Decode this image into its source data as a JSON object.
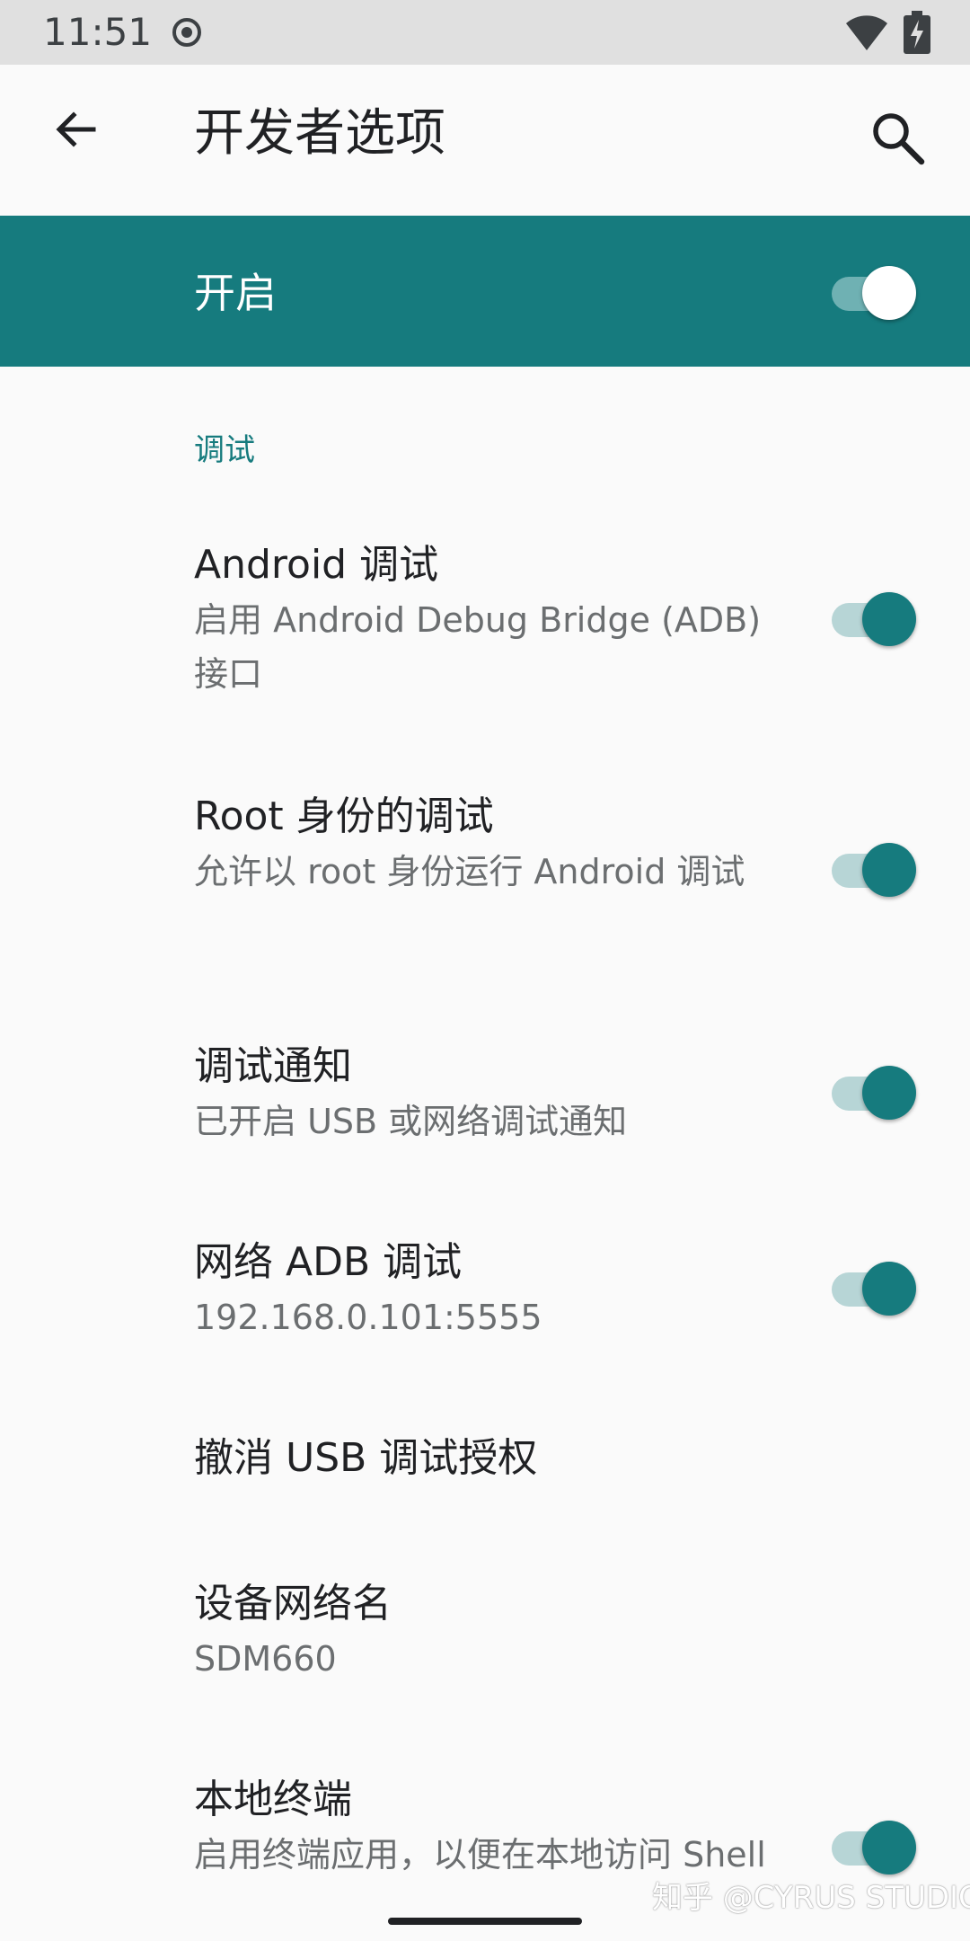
{
  "status_bar": {
    "time": "11:51",
    "icons": [
      "record-icon",
      "wifi-icon",
      "battery-charging-icon"
    ]
  },
  "app_bar": {
    "title": "开发者选项",
    "back_icon": "arrow-back-icon",
    "search_icon": "search-icon"
  },
  "master_switch": {
    "label": "开启",
    "checked": true,
    "color": "#167b7e"
  },
  "section": {
    "header": "调试"
  },
  "prefs": [
    {
      "title": "Android 调试",
      "summary": "启用 Android Debug Bridge (ADB) 接口",
      "checked": true
    },
    {
      "title": "Root 身份的调试",
      "summary": "允许以 root 身份运行 Android 调试",
      "checked": true
    },
    {
      "title": "调试通知",
      "summary": "已开启 USB 或网络调试通知",
      "checked": true
    },
    {
      "title": "网络 ADB 调试",
      "summary": "192.168.0.101:5555",
      "checked": true
    },
    {
      "title": "撤消 USB 调试授权"
    },
    {
      "title": "设备网络名",
      "summary": "SDM660"
    },
    {
      "title": "本地终端",
      "summary": "启用终端应用，以便在本地访问 Shell",
      "checked": true
    }
  ],
  "watermark": "知乎 @CYRUS STUDIO",
  "colors": {
    "accent": "#167b7e",
    "switch_track": "#b7d5d6",
    "background": "#fafafa",
    "status_bar": "#e0e0e0"
  }
}
